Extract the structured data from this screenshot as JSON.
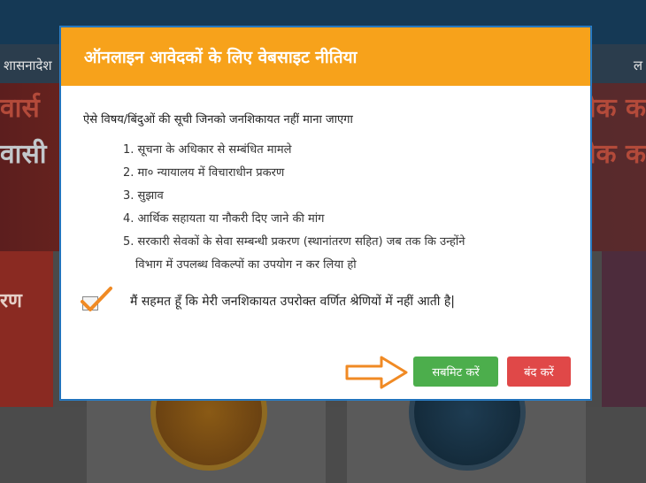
{
  "background": {
    "nav_left": "शासनादेश",
    "nav_right": "ल",
    "banner_left_1": "वार्स",
    "banner_left_2": "वासी",
    "banner_right_1": "लेक क",
    "banner_right_2": "लेक क",
    "side_left": "रण"
  },
  "modal": {
    "title": "ऑनलाइन आवेदकों के लिए वेबसाइट नीतिया",
    "lead": "ऐसे विषय/बिंदुओं की सूची जिनको जनशिकायत नहीं माना जाएगा",
    "items": [
      "1. सूचना के अधिकार से सम्बंधित मामले",
      "2. मा० न्यायालय में विचाराधीन प्रकरण",
      "3. सुझाव",
      "4. आर्थिक सहायता या नौकरी दिए जाने की मांग",
      "5. सरकारी सेवकों के सेवा सम्बन्धी प्रकरण (स्थानांतरण सहित) जब तक कि उन्होंने"
    ],
    "item5_cont": "विभाग में उपलब्ध विकल्पों का उपयोग न कर लिया हो",
    "agree_text": "मैं सहमत हूँ कि मेरी जनशिकायत उपरोक्त वर्णित श्रेणियों में नहीं आती है|",
    "submit_label": "सबमिट करें",
    "close_label": "बंद करें"
  },
  "colors": {
    "header": "#f7a21b",
    "submit": "#4cae4c",
    "close": "#e04848",
    "annotation": "#f08a24"
  }
}
